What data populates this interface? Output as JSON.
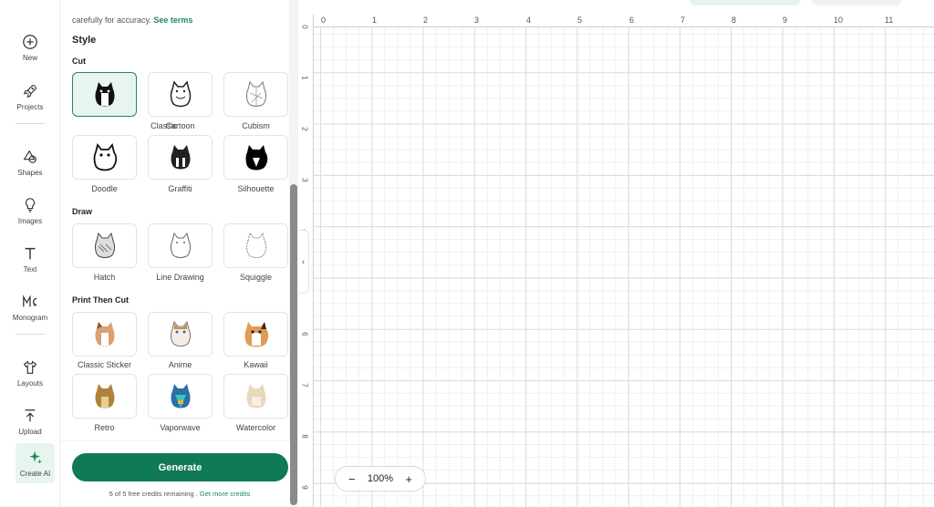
{
  "rail": {
    "items": [
      {
        "label": "New",
        "icon": "plus-circle-icon"
      },
      {
        "label": "Projects",
        "icon": "rocket-icon"
      },
      {
        "label": "Shapes",
        "icon": "shapes-icon"
      },
      {
        "label": "Images",
        "icon": "lightbulb-icon"
      },
      {
        "label": "Text",
        "icon": "text-icon"
      },
      {
        "label": "Monogram",
        "icon": "monogram-icon"
      },
      {
        "label": "Layouts",
        "icon": "shirt-icon"
      },
      {
        "label": "Upload",
        "icon": "upload-icon"
      },
      {
        "label": "Create AI",
        "icon": "sparkle-icon"
      }
    ],
    "active": "Create AI"
  },
  "panel": {
    "top_text": "carefully for accuracy.",
    "see_terms": "See terms",
    "style_heading": "Style",
    "sections": {
      "cut": "Cut",
      "draw": "Draw",
      "print_then_cut": "Print Then Cut"
    },
    "styles": {
      "cut": [
        "Classic",
        "Cartoon",
        "Cubism",
        "Doodle",
        "Graffiti",
        "Silhouette"
      ],
      "draw": [
        "Hatch",
        "Line Drawing",
        "Squiggle"
      ],
      "print_then_cut": [
        "Classic Sticker",
        "Anime",
        "Kawaii",
        "Retro",
        "Vaporwave",
        "Watercolor"
      ]
    },
    "selected_style": "Classic",
    "generate_label": "Generate",
    "credits_text": "5 of 5 free credits remaining .",
    "get_more_credits": "Get more credits"
  },
  "canvas": {
    "ruler_x": [
      "0",
      "1",
      "2",
      "3",
      "4",
      "5",
      "6",
      "7",
      "8",
      "9",
      "10",
      "11"
    ],
    "ruler_y": [
      "0",
      "1",
      "2",
      "3",
      "4",
      "5",
      "6",
      "7",
      "8",
      "9"
    ],
    "zoom_level": "100%",
    "zoom_out": "−",
    "zoom_in": "+"
  },
  "colors": {
    "accent": "#0f7a54",
    "selected_bg": "#e8f5ee"
  }
}
